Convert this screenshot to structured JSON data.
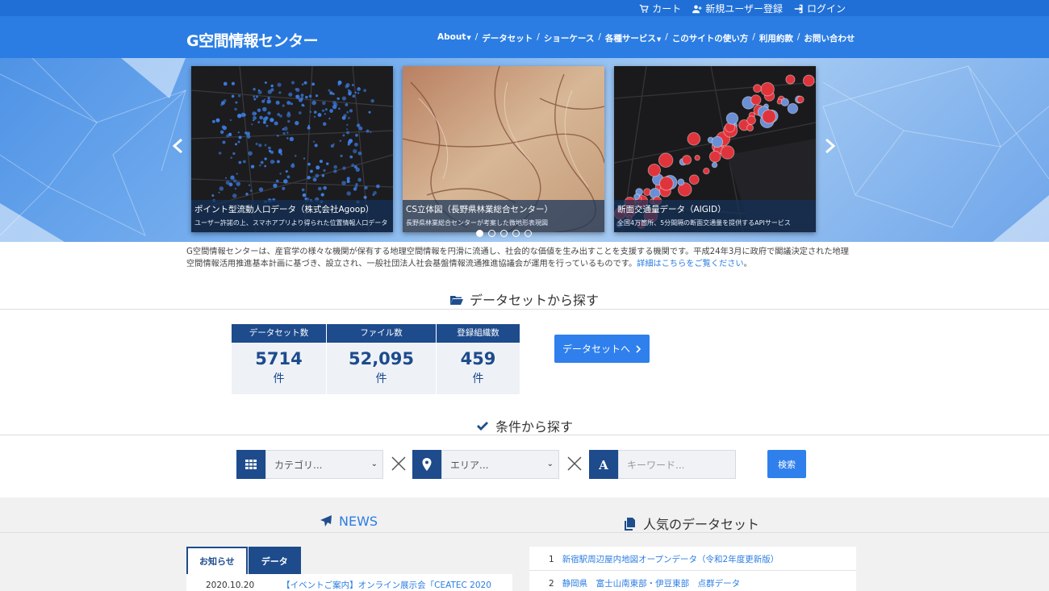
{
  "topbar": {
    "cart": "カート",
    "register": "新規ユーザー登録",
    "login": "ログイン"
  },
  "header": {
    "logo": "G空間情報センター",
    "nav": [
      {
        "label": "About",
        "dropdown": true
      },
      {
        "label": "データセット",
        "dropdown": false
      },
      {
        "label": "ショーケース",
        "dropdown": false
      },
      {
        "label": "各種サービス",
        "dropdown": true
      },
      {
        "label": "このサイトの使い方",
        "dropdown": false
      },
      {
        "label": "利用約款",
        "dropdown": false
      },
      {
        "label": "お問い合わせ",
        "dropdown": false
      }
    ],
    "separator": "/"
  },
  "carousel": {
    "slides": [
      {
        "title": "ポイント型流動人口データ（株式会社Agoop）",
        "description": "ユーザー許諾の上、スマホアプリより得られた位置情報人口データ"
      },
      {
        "title": "CS立体図（長野県林業総合センター）",
        "description": "長野県林業総合センターが考案した微地形表現図"
      },
      {
        "title": "断面交通量データ（AIGID）",
        "description": "全国4万箇所、5分間隔の断面交通量を提供するAPIサービス"
      }
    ],
    "dot_count": 5,
    "active_dot": 0
  },
  "intro": {
    "text": "G空間情報センターは、産官学の様々な機関が保有する地理空間情報を円滑に流通し、社会的な価値を生み出すことを支援する機関です。平成24年3月に政府で閣議決定された地理空間情報活用推進基本計画に基づき、設立され、一般社団法人社会基盤情報流通推進協議会が運用を行っているものです。",
    "link": "詳細はこちらをご覧ください",
    "tail": "。"
  },
  "dataset_section": {
    "title": "データセットから探す",
    "stats": [
      {
        "label": "データセット数",
        "value": "5714",
        "unit": "件"
      },
      {
        "label": "ファイル数",
        "value": "52,095",
        "unit": "件"
      },
      {
        "label": "登録組織数",
        "value": "459",
        "unit": "件"
      }
    ],
    "button": "データセットへ"
  },
  "search_section": {
    "title": "条件から探す",
    "category_placeholder": "カテゴリ...",
    "area_placeholder": "エリア...",
    "keyword_placeholder": "キーワード...",
    "button": "検索"
  },
  "news": {
    "title": "NEWS",
    "tabs": [
      "お知らせ",
      "データ"
    ],
    "items": [
      {
        "date": "2020.10.20",
        "title": "【イベントご案内】オンライン展示会「CEATEC 2020"
      }
    ]
  },
  "popular": {
    "title": "人気のデータセット",
    "items": [
      {
        "rank": "1",
        "title": "新宿駅周辺屋内地図オープンデータ（令和2年度更新版）"
      },
      {
        "rank": "2",
        "title": "静岡県　富士山南東部・伊豆東部　点群データ"
      }
    ]
  },
  "colors": {
    "primary": "#2b7de3",
    "navy": "#1d4b8c",
    "button": "#2f80ed"
  }
}
